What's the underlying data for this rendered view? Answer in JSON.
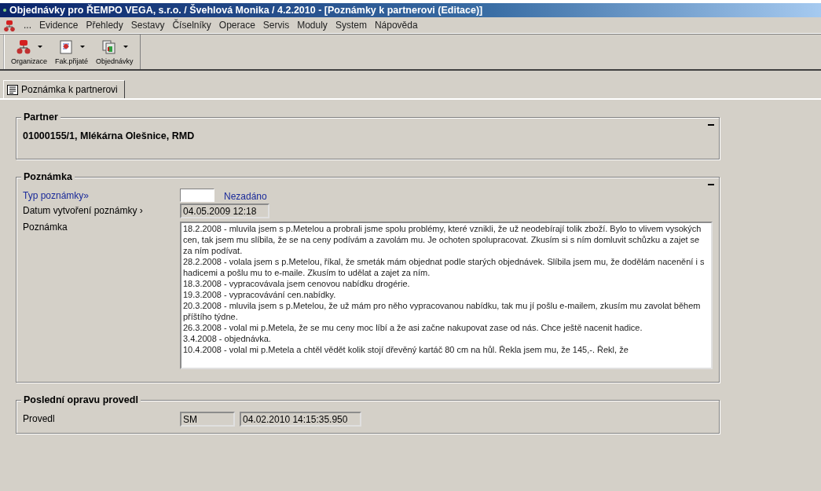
{
  "window": {
    "title": "Objednávky pro ŘEMPO VEGA, s.r.o. / Švehlová Monika / 4.2.2010 - [Poznámky k partnerovi (Editace)]"
  },
  "menu": {
    "more": "...",
    "items": [
      "Evidence",
      "Přehledy",
      "Sestavy",
      "Číselníky",
      "Operace",
      "Servis",
      "Moduly",
      "System",
      "Nápověda"
    ]
  },
  "toolbar": [
    {
      "label": "Organizace",
      "kind": "org"
    },
    {
      "label": "Fak.přijaté",
      "kind": "invoice"
    },
    {
      "label": "Objednávky",
      "kind": "orders"
    }
  ],
  "tabs": [
    {
      "label": "Poznámka k partnerovi",
      "selected": true
    }
  ],
  "partner": {
    "title": "Partner",
    "value": "01000155/1, Mlékárna Olešnice, RMD"
  },
  "note": {
    "title": "Poznámka",
    "type_label": "Typ poznámky»",
    "type_value": "Nezadáno",
    "date_label": "Datum vytvoření poznámky ›",
    "date_value": "04.05.2009 12:18",
    "text_label": "Poznámka",
    "entries": [
      "18.2.2008 - mluvila jsem s p.Metelou a probrali jsme spolu problémy, které vznikli, že už neodebírají tolik zboží. Bylo to vlivem vysokých cen, tak jsem mu slíbila, že se na ceny podívám a zavolám mu. Je ochoten spolupracovat. Zkusím si s ním domluvit schůzku a zajet se za ním podívat.",
      "28.2.2008 - volala jsem s p.Metelou, říkal, že smeták mám objednat podle starých objednávek. Slíbila jsem mu, že dodělám nacenění i s hadicemi a pošlu mu to e-maile. Zkusím to udělat a zajet za ním.",
      "18.3.2008 - vypracovávala jsem cenovou nabídku drogérie.",
      "19.3.2008 - vypracovávání cen.nabídky.",
      "20.3.2008 - mluvila jsem s p.Metelou, že už mám pro něho vypracovanou nabídku, tak mu jí pošlu e-mailem, zkusím mu zavolat během příštího týdne.",
      "26.3.2008 - volal mi p.Metela, že se mu ceny moc líbí a že asi začne nakupovat zase od nás. Chce ještě nacenit hadice.",
      "3.4.2008 - objednávka.",
      "10.4.2008 - volal mi p.Metela a chtěl vědět kolik stojí dřevěný kartáč 80 cm na hůl. Řekla jsem mu, že 145,-. Řekl, že"
    ]
  },
  "last_edit": {
    "title": "Poslední opravu provedl",
    "label": "Provedl",
    "user": "SM",
    "timestamp": "04.02.2010 14:15:35.950"
  }
}
